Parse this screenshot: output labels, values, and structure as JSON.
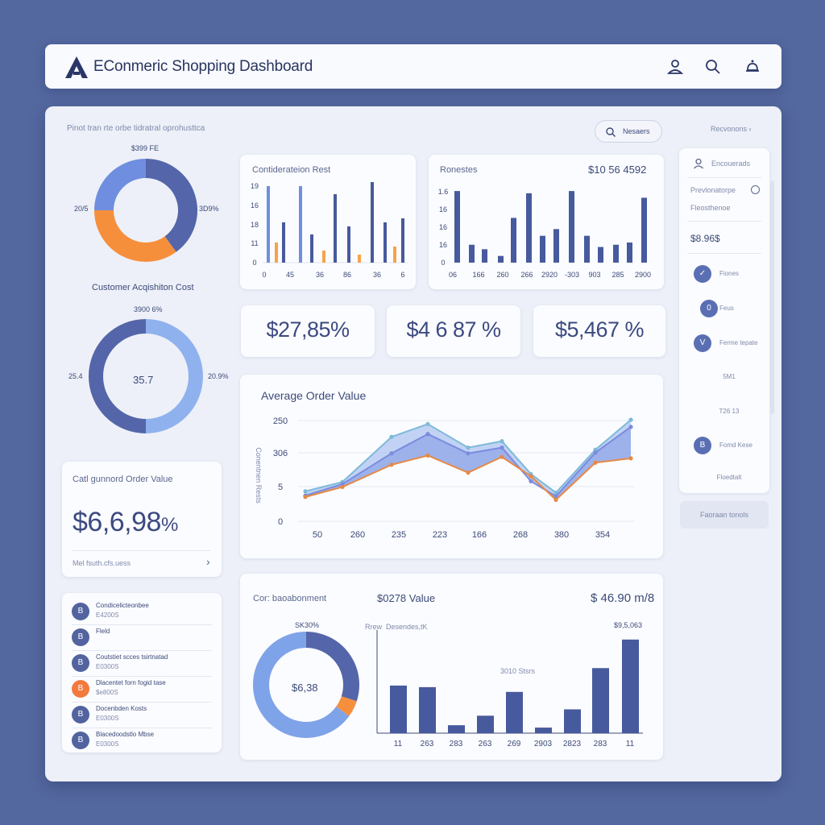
{
  "header": {
    "title": "EConmeric Shopping Dashboard",
    "icons": [
      "user-icon",
      "search-icon",
      "bell-icon"
    ]
  },
  "top_strip": {
    "caption": "Pinot tran rte orbe tidratral oprohusttca",
    "search_label": "Nesaers",
    "right_label": "Recvonons"
  },
  "donut1": {
    "top_label": "$399 FE",
    "left_label": "20/5",
    "right_label": "3D9%"
  },
  "donut2": {
    "title": "Customer Acqishiton Cost",
    "top_label": "3900 6%",
    "center": "35.7",
    "left_label": "25.4",
    "right_label": "20.9%"
  },
  "card_cov": {
    "title": "Catl gunnord Order Value",
    "value": "$6,6,98",
    "unit": "%",
    "link": "Mel fsuth.cfs.uess",
    "chevron": "›"
  },
  "left_list": [
    {
      "title": "Condicelicteonbee",
      "sub": "E4200S",
      "icon": "B",
      "color": "blue"
    },
    {
      "title": "Fleld",
      "sub": "",
      "icon": "B",
      "color": "blue"
    },
    {
      "title": "Coutstiet scces tsirtnatad",
      "sub": "E0300S",
      "icon": "B",
      "color": "blue"
    },
    {
      "title": "Dlacentet forn fogid tase",
      "sub": "$e800S",
      "icon": "B",
      "color": "orange"
    },
    {
      "title": "Docenbden Kosts",
      "sub": "E0300S",
      "icon": "B",
      "color": "blue"
    },
    {
      "title": "Blacedoodstlo Mbse",
      "sub": "E0300S",
      "icon": "B",
      "color": "blue"
    }
  ],
  "bar1": {
    "title": "Contiderateion Rest",
    "y_ticks": [
      "19",
      "16",
      "18",
      "11",
      "0"
    ],
    "x_ticks": [
      "0",
      "45",
      "36",
      "86",
      "36",
      "6"
    ]
  },
  "bar2": {
    "title": "Ronestes",
    "value": "$10 56 4592",
    "y_ticks": [
      "1.6",
      "16",
      "16",
      "16",
      "0"
    ],
    "x_ticks": [
      "06",
      "166",
      "260",
      "266",
      "2920",
      "-303",
      "903",
      "285",
      "2900"
    ]
  },
  "kpis": [
    {
      "value": "$27,85%"
    },
    {
      "value": "$4 6 87 %"
    },
    {
      "value": "$5,467 %"
    }
  ],
  "aov": {
    "title": "Average Order Value",
    "y_axis_label": "Conentnen Rests",
    "y_ticks": [
      "250",
      "306",
      "5",
      "0"
    ],
    "x_ticks": [
      "50",
      "260",
      "235",
      "223",
      "166",
      "268",
      "380",
      "354"
    ]
  },
  "bottom": {
    "title": "Cor: baoabonment",
    "mid_title": "$0278 Value",
    "right_value": "$ 46.90 m/8",
    "donut_top": "SK30%",
    "donut_center": "$6,38",
    "legend_a": "Rrew",
    "legend_b": "Desendes,tK",
    "peak_label": "$9,5,063",
    "mid_label": "3010 Stsrs",
    "x_ticks": [
      "11",
      "263",
      "283",
      "263",
      "269",
      "2903",
      "2823",
      "283",
      "11"
    ]
  },
  "right_panel": {
    "header": "Encouerads",
    "line1": "Prevlonatorpe",
    "line2": "Fleosthenoe",
    "value": "$8.96$",
    "items": [
      {
        "label": "Fiones",
        "icon": "✓"
      },
      {
        "label": "Feus",
        "icon": "0"
      },
      {
        "label": "Ferme tepate",
        "icon": "V"
      },
      {
        "label": "5M1",
        "icon": ""
      },
      {
        "label": "T26 13",
        "icon": ""
      },
      {
        "label": "Fomd Kese",
        "icon": "B"
      },
      {
        "label": "Floedtalt",
        "icon": ""
      }
    ],
    "button": "Faoraan tonols"
  },
  "chart_data": [
    {
      "type": "pie",
      "title": "",
      "labels": [
        "",
        "",
        ""
      ],
      "values": [
        40,
        35,
        25
      ],
      "colors": [
        "#5466a9",
        "#f68f3c",
        "#6f8ee0"
      ]
    },
    {
      "type": "pie",
      "title": "Customer Acqishiton Cost",
      "values": [
        50,
        50
      ],
      "colors": [
        "#8fb1ee",
        "#5466a9"
      ]
    },
    {
      "type": "bar",
      "title": "Contiderateion Rest",
      "series": [
        {
          "values": [
            19,
            10,
            19,
            17,
            20,
            10,
            11
          ]
        },
        {
          "values": [
            5,
            3,
            2,
            4
          ]
        }
      ],
      "ylim": [
        0,
        20
      ]
    },
    {
      "type": "bar",
      "title": "Ronestes",
      "values": [
        1.6,
        0.4,
        0.3,
        0.15,
        1.0,
        1.55,
        0.6,
        0.75,
        1.6,
        0.6,
        0.35,
        0.4,
        0.45,
        1.45
      ],
      "ylim": [
        0,
        1.8
      ]
    },
    {
      "type": "area",
      "title": "Average Order Value",
      "ylabel": "Conentnen Rests",
      "x": [
        "50",
        "260",
        "235",
        "223",
        "166",
        "268",
        "380",
        "354"
      ],
      "series": [
        {
          "values": [
            42,
            55,
            118,
            136,
            103,
            112,
            66,
            40,
            100,
            142
          ]
        },
        {
          "values": [
            36,
            52,
            95,
            122,
            95,
            103,
            56,
            35,
            96,
            132
          ]
        },
        {
          "values": [
            34,
            48,
            79,
            92,
            68,
            90,
            63,
            30,
            82,
            88
          ]
        }
      ],
      "ylim": [
        0,
        160
      ],
      "colors": [
        "#7dbad8",
        "#7a8cde",
        "#e58a46"
      ]
    },
    {
      "type": "pie",
      "title": "Cor: baoabonment",
      "values": [
        30,
        5,
        65
      ],
      "colors": [
        "#5466a9",
        "#f68f3c",
        "#7fa3e8"
      ]
    },
    {
      "type": "bar",
      "title": "$0278 Value",
      "categories": [
        "11",
        "263",
        "283",
        "263",
        "269",
        "2903",
        "2823",
        "283",
        "11"
      ],
      "values": [
        60,
        58,
        10,
        22,
        52,
        7,
        30,
        82,
        118
      ],
      "ylim": [
        0,
        130
      ]
    }
  ]
}
